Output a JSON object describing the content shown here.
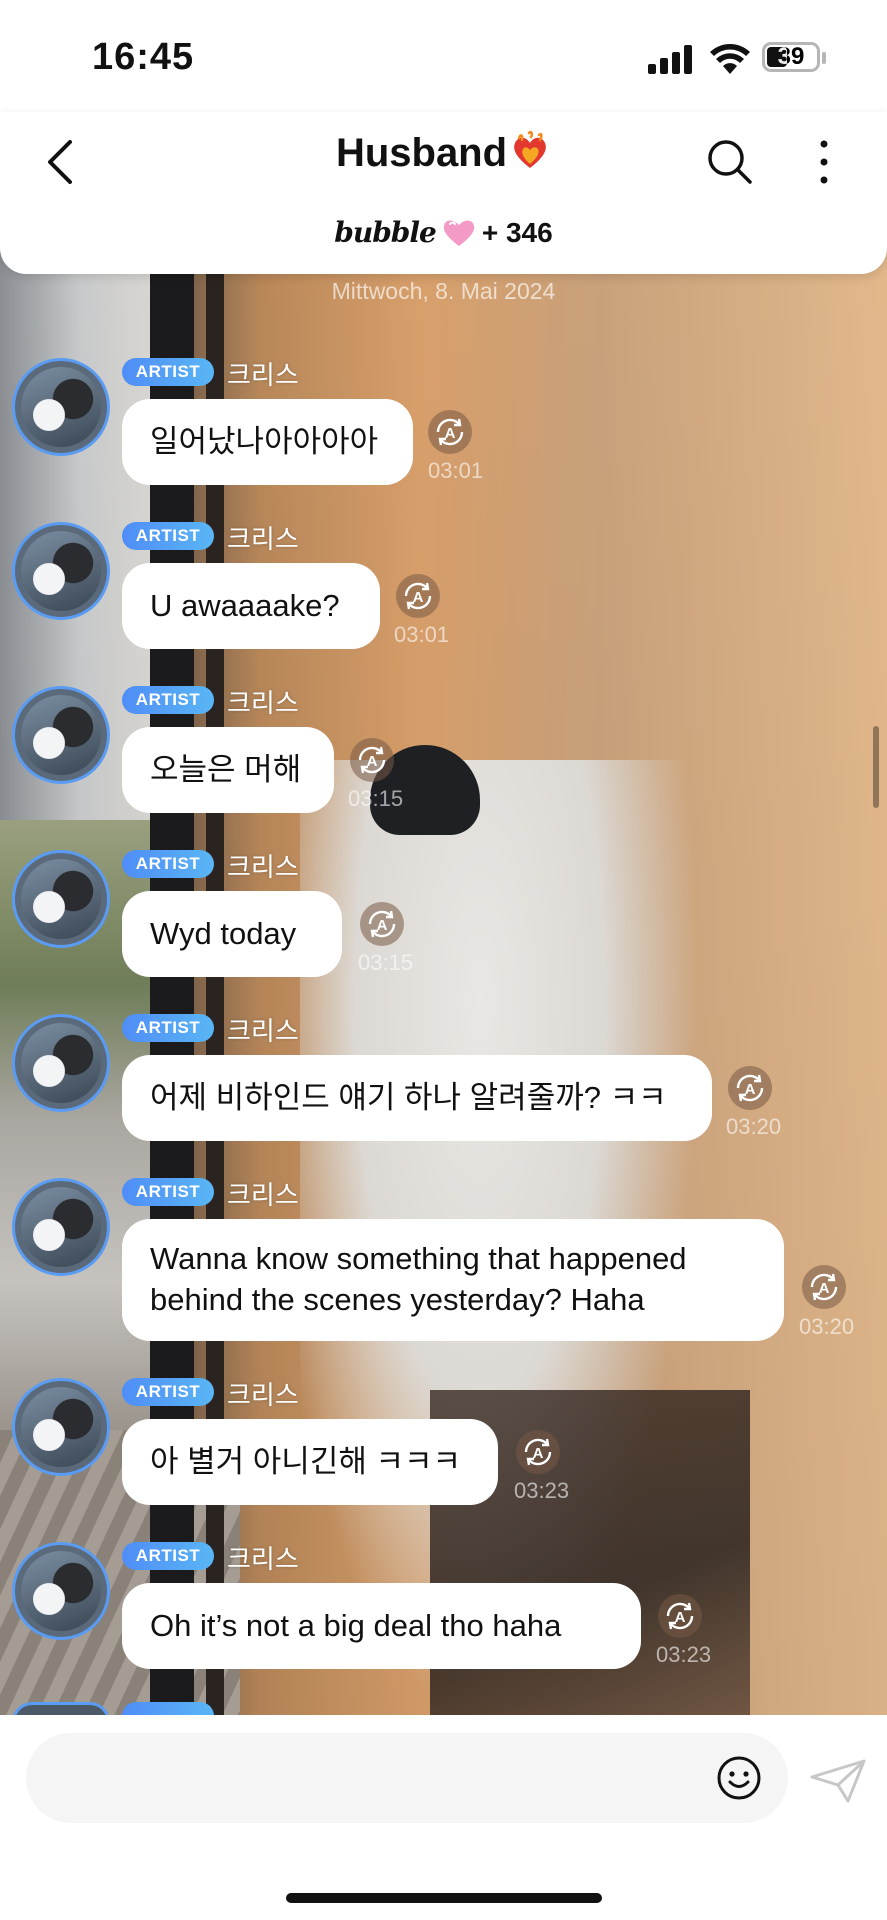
{
  "status_bar": {
    "time": "16:45",
    "battery": "39"
  },
  "header": {
    "title": "Husband",
    "title_emoji": "burning-heart-icon",
    "bubble_brand": "bubble",
    "bubble_count": "+ 346"
  },
  "date_separator": "Mittwoch, 8. Mai 2024",
  "badge_label": "ARTIST",
  "messages": [
    {
      "sender": "크리스",
      "text": "일어났나아아아아",
      "time": "03:01"
    },
    {
      "sender": "크리스",
      "text": "U awaaaake?",
      "time": "03:01"
    },
    {
      "sender": "크리스",
      "text": "오늘은 머해",
      "time": "03:15"
    },
    {
      "sender": "크리스",
      "text": "Wyd today",
      "time": "03:15"
    },
    {
      "sender": "크리스",
      "text": "어제 비하인드 얘기 하나 알려줄까? ㅋㅋ",
      "time": "03:20"
    },
    {
      "sender": "크리스",
      "text_line1": "Wanna know something that happened",
      "text_line2": "behind the scenes yesterday? Haha",
      "time": "03:20"
    },
    {
      "sender": "크리스",
      "text": "아 별거 아니긴해 ㅋㅋㅋ",
      "time": "03:23"
    },
    {
      "sender": "크리스",
      "text": "Oh it’s not a big deal tho haha",
      "time": "03:23"
    }
  ],
  "composer": {
    "placeholder": ""
  },
  "colors": {
    "accent_blue": "#4f8df7",
    "badge_gradient_end": "#59b6f5",
    "heart_pink": "#f39bc6"
  }
}
